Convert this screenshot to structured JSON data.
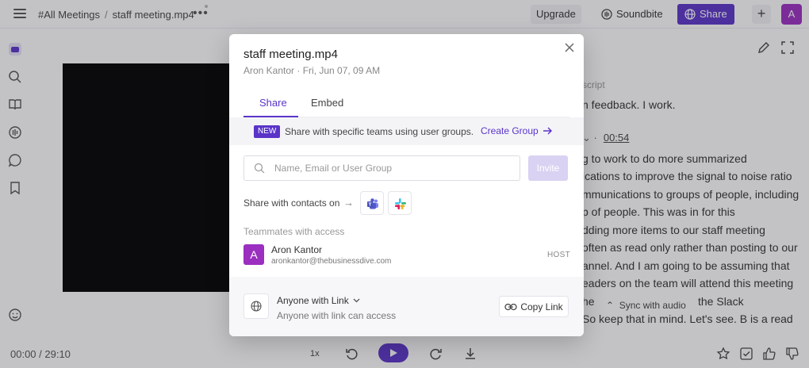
{
  "topbar": {
    "breadcrumb_root": "#All Meetings",
    "breadcrumb_separator": "/",
    "breadcrumb_file": "staff meeting.mp4",
    "more": "•••",
    "upgrade": "Upgrade",
    "soundbite": "Soundbite",
    "share": "Share",
    "add": "+",
    "avatar": "A"
  },
  "transcript": {
    "header": "script",
    "line0": "n feedback. I work.",
    "speaker_chevron": "⌄  ·",
    "timestamp": "00:54",
    "lines": [
      "g to work to do more summarized",
      "ications to improve the signal to noise ratio",
      "mmunications to groups of people, including",
      "p of people. This was in for this",
      "dding more items to our staff meeting",
      "often as read only rather than posting to our",
      "annel. And I am going to be assuming that",
      "eaders on the team will attend this meeting",
      "he",
      "So keep that in mind. Let's see. B is a read"
    ],
    "the_slack": "the Slack",
    "sync": "Sync with audio"
  },
  "player": {
    "time": "00:00 / 29:10",
    "speed": "1x"
  },
  "modal": {
    "title": "staff meeting.mp4",
    "subtitle": "Aron Kantor · Fri, Jun 07, 09 AM",
    "tabs": [
      "Share",
      "Embed"
    ],
    "banner_badge": "NEW",
    "banner_text": "Share with specific teams using user groups.",
    "banner_link": "Create Group",
    "search_placeholder": "Name, Email or User Group",
    "invite": "Invite",
    "contacts_text": "Share with contacts on",
    "teammates_label": "Teammates with access",
    "teammate": {
      "initial": "A",
      "name": "Aron Kantor",
      "email": "aronkantor@thebusinessdive.com",
      "role": "HOST"
    },
    "link_access": "Anyone with Link",
    "link_desc": "Anyone with link can access",
    "copy_link": "Copy Link"
  },
  "colors": {
    "accent": "#5a34c8",
    "avatar": "#9b2fbf"
  },
  "icons": [
    "hamburger-icon",
    "soundbite-icon",
    "globe-icon",
    "teams-icon",
    "slack-icon",
    "search-icon",
    "close-icon",
    "link-icon",
    "play-icon",
    "rewind-icon",
    "forward-icon",
    "download-icon",
    "star-icon",
    "checkbox-icon",
    "thumbs-up-icon",
    "thumbs-down-icon"
  ]
}
